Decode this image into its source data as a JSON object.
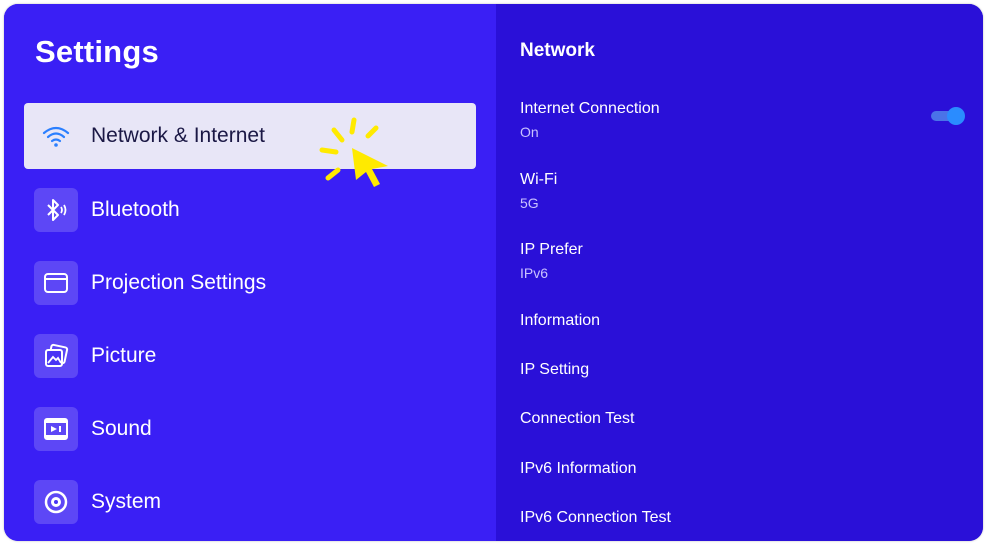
{
  "app": {
    "title": "Settings"
  },
  "sidebar": {
    "items": [
      {
        "label": "Network & Internet",
        "icon": "wifi-icon",
        "selected": true
      },
      {
        "label": "Bluetooth",
        "icon": "bluetooth-icon",
        "selected": false
      },
      {
        "label": "Projection Settings",
        "icon": "projection-icon",
        "selected": false
      },
      {
        "label": "Picture",
        "icon": "picture-icon",
        "selected": false
      },
      {
        "label": "Sound",
        "icon": "sound-icon",
        "selected": false
      },
      {
        "label": "System",
        "icon": "system-icon",
        "selected": false
      }
    ]
  },
  "panel": {
    "title": "Network",
    "rows": [
      {
        "title": "Internet Connection",
        "value": "On",
        "toggle": true
      },
      {
        "title": "Wi-Fi",
        "value": "5G"
      },
      {
        "title": "IP Prefer",
        "value": "IPv6"
      },
      {
        "title": "Information"
      },
      {
        "title": "IP Setting"
      },
      {
        "title": "Connection Test"
      },
      {
        "title": "IPv6 Information"
      },
      {
        "title": "IPv6 Connection Test"
      }
    ]
  },
  "colors": {
    "left_bg": "#3a1ff5",
    "right_bg": "#2a10d8",
    "selected_bg": "#e8e6f7",
    "toggle_on": "#2a8cff",
    "cursor": "#ffea00"
  }
}
